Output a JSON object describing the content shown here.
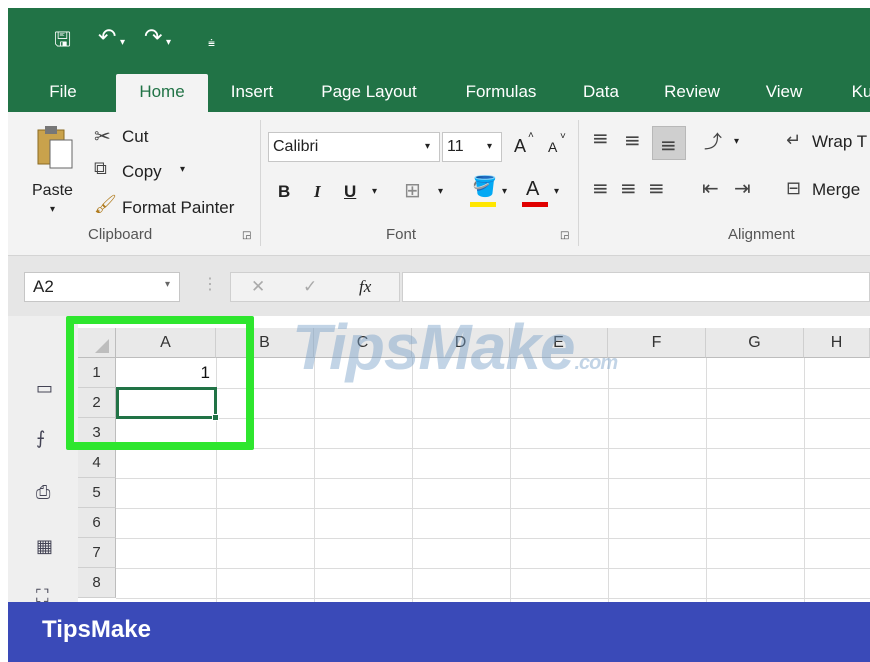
{
  "quick_access": {
    "save_icon": "save-icon",
    "undo_icon": "undo-icon",
    "redo_icon": "redo-icon",
    "customize_icon": "customize-quick-access-icon"
  },
  "tabs": [
    {
      "label": "File"
    },
    {
      "label": "Home"
    },
    {
      "label": "Insert"
    },
    {
      "label": "Page Layout"
    },
    {
      "label": "Formulas"
    },
    {
      "label": "Data"
    },
    {
      "label": "Review"
    },
    {
      "label": "View"
    },
    {
      "label": "Ku"
    }
  ],
  "ribbon": {
    "clipboard": {
      "paste_label": "Paste",
      "cut_label": "Cut",
      "copy_label": "Copy",
      "format_painter_label": "Format Painter",
      "group_label": "Clipboard"
    },
    "font": {
      "font_name": "Calibri",
      "font_size": "11",
      "bold": "B",
      "italic": "I",
      "underline": "U",
      "font_color_letter": "A",
      "grow_font": "A",
      "shrink_font": "A",
      "group_label": "Font"
    },
    "alignment": {
      "wrap_text_label": "Wrap T",
      "merge_label": "Merge",
      "group_label": "Alignment"
    }
  },
  "formula_bar": {
    "name_box": "A2",
    "cancel_symbol": "✕",
    "enter_symbol": "✓",
    "fx_label": "fx",
    "value": ""
  },
  "sheet": {
    "columns": [
      "A",
      "B",
      "C",
      "D",
      "E",
      "F",
      "G",
      "H"
    ],
    "rows": [
      "1",
      "2",
      "3",
      "4",
      "5",
      "6",
      "7",
      "8"
    ],
    "cells": {
      "A1": "1",
      "A2": ""
    },
    "selected_cell": "A2"
  },
  "watermark": {
    "text_main": "TipsMake",
    "text_suffix": ".com"
  },
  "footer": {
    "brand": "TipsMake"
  },
  "colors": {
    "excel_green": "#217346",
    "highlight_green": "#2ee62e",
    "footer_blue": "#3a4ab8",
    "font_color_red": "#e00000",
    "highlight_yellow": "#ffe600"
  }
}
